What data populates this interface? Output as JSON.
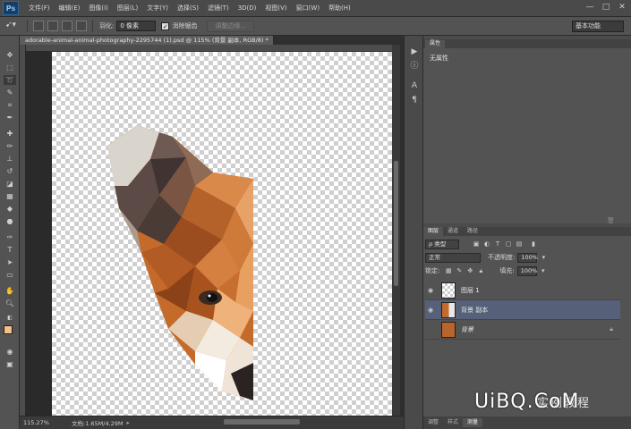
{
  "app": {
    "logo": "Ps"
  },
  "menu": [
    "文件(F)",
    "编辑(E)",
    "图像(I)",
    "图层(L)",
    "文字(Y)",
    "选择(S)",
    "滤镜(T)",
    "3D(D)",
    "视图(V)",
    "窗口(W)",
    "帮助(H)"
  ],
  "window_controls": {
    "minimize": "—",
    "restore": "□",
    "close": "✕"
  },
  "options": {
    "feather_label": "羽化:",
    "feather_value": "0 像素",
    "antialias_label": "消除锯齿",
    "refine_edge_label": "调整边缘...",
    "workspace": "基本功能"
  },
  "document": {
    "tab_title": "adorable-animal-animal-photography-2295744 (1).psd @ 115% (背景 副本, RGB/8) *",
    "tab_close": "×",
    "zoom": "115.27%",
    "doc_info": "文档:1.65M/4.29M"
  },
  "properties": {
    "tab": "属性",
    "empty_text": "无属性"
  },
  "layers_panel": {
    "tabs": [
      "图层",
      "通道",
      "路径"
    ],
    "filter_label": "ρ 类型",
    "blend_mode": "正常",
    "opacity_label": "不透明度:",
    "opacity_value": "100%",
    "lock_label": "锁定:",
    "fill_label": "填充:",
    "fill_value": "100%",
    "layers": [
      {
        "name": "图层 1",
        "visible": true,
        "selected": false,
        "locked": false
      },
      {
        "name": "背景 副本",
        "visible": true,
        "selected": true,
        "locked": false
      },
      {
        "name": "背景",
        "visible": false,
        "selected": false,
        "locked": true
      }
    ],
    "footer_tabs": [
      "调整",
      "样式",
      "测量"
    ]
  },
  "watermark": {
    "text": "UiBQ.CoM",
    "cn": "实例教程"
  },
  "colors": {
    "foreground": "#f4c08a",
    "background": "#ffffff",
    "selected_layer": "#566179"
  }
}
